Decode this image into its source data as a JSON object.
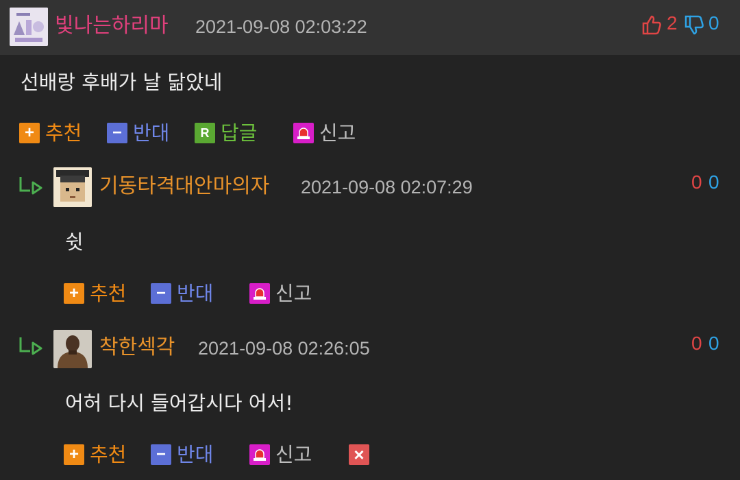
{
  "main_comment": {
    "nickname": "빛나는하리마",
    "date": "2021-09-08 02:03:22",
    "upvotes": "2",
    "downvotes": "0",
    "text": "선배랑 후배가 날 닮았네",
    "actions": {
      "recommend": "추천",
      "oppose": "반대",
      "reply_icon": "R",
      "reply": "답글",
      "report": "신고"
    }
  },
  "replies": [
    {
      "nickname": "기동타격대안마의자",
      "date": "2021-09-08 02:07:29",
      "upvotes": "0",
      "downvotes": "0",
      "text": "쉿",
      "actions": {
        "recommend": "추천",
        "oppose": "반대",
        "report": "신고"
      }
    },
    {
      "nickname": "착한섹각",
      "date": "2021-09-08 02:26:05",
      "upvotes": "0",
      "downvotes": "0",
      "text": "어허 다시 들어갑시다 어서!",
      "actions": {
        "recommend": "추천",
        "oppose": "반대",
        "report": "신고"
      }
    }
  ],
  "icons": {
    "recommend": "plus-icon",
    "oppose": "minus-icon",
    "reply": "reply-r-icon",
    "report": "siren-icon",
    "delete": "close-icon",
    "thumbs_up": "thumbs-up-icon",
    "thumbs_down": "thumbs-down-icon",
    "reply_arrow": "reply-arrow-icon"
  },
  "colors": {
    "background": "#232323",
    "header_background": "#333333",
    "nickname_pink": "#e0407c",
    "nickname_orange": "#e8922a",
    "upvote_red": "#e04545",
    "downvote_blue": "#2ea3e6",
    "recommend_orange": "#f08a14",
    "oppose_blue": "#5c6fd6",
    "reply_green": "#5aa832",
    "report_magenta": "#d81ec8",
    "delete_red": "#e05555"
  }
}
